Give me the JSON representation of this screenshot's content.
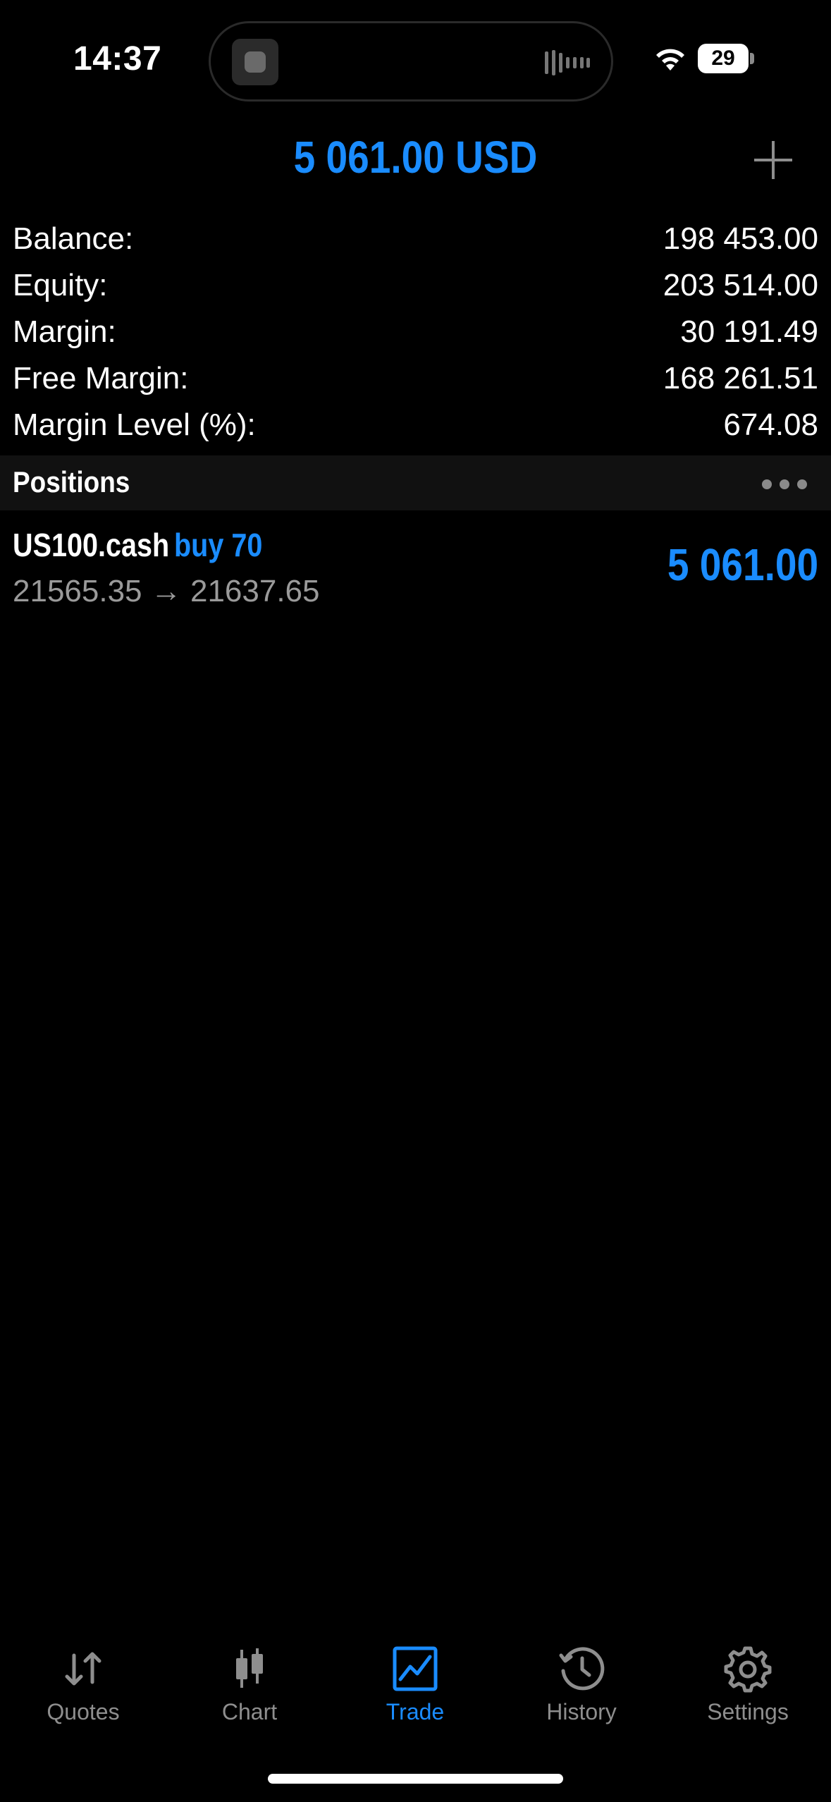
{
  "status_bar": {
    "time": "14:37",
    "battery": "29"
  },
  "header": {
    "total": "5 061.00 USD",
    "add_icon": "plus-icon"
  },
  "account": {
    "rows": [
      {
        "label": "Balance:",
        "value": "198 453.00"
      },
      {
        "label": "Equity:",
        "value": "203 514.00"
      },
      {
        "label": "Margin:",
        "value": "30 191.49"
      },
      {
        "label": "Free Margin:",
        "value": "168 261.51"
      },
      {
        "label": "Margin Level (%):",
        "value": "674.08"
      }
    ]
  },
  "positions": {
    "title": "Positions",
    "items": [
      {
        "symbol": "US100.cash",
        "side": "buy 70",
        "prices": "21565.35 → 21637.65",
        "profit": "5 061.00"
      }
    ]
  },
  "tabs": [
    {
      "label": "Quotes",
      "icon": "arrows-updown-icon",
      "active": false
    },
    {
      "label": "Chart",
      "icon": "candlestick-icon",
      "active": false
    },
    {
      "label": "Trade",
      "icon": "trade-chart-icon",
      "active": true
    },
    {
      "label": "History",
      "icon": "history-clock-icon",
      "active": false
    },
    {
      "label": "Settings",
      "icon": "gear-icon",
      "active": false
    }
  ],
  "colors": {
    "accent": "#1a8cff",
    "background": "#000000",
    "secondary_text": "#9a9a9a",
    "section_bg": "#111111"
  }
}
